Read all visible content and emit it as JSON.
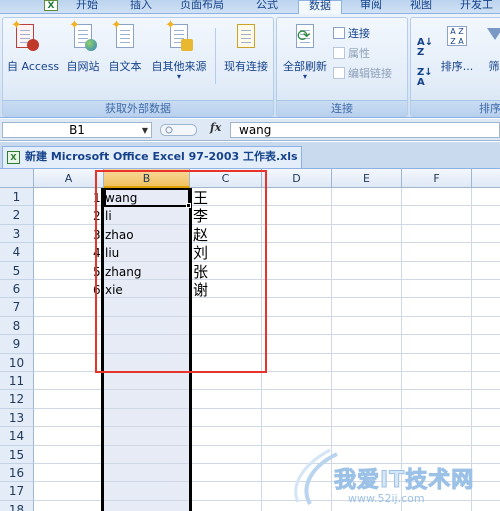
{
  "ribbon": {
    "tabs": [
      {
        "label": "开始",
        "active": false
      },
      {
        "label": "插入",
        "active": false
      },
      {
        "label": "页面布局",
        "active": false
      },
      {
        "label": "公式",
        "active": false
      },
      {
        "label": "数据",
        "active": true
      },
      {
        "label": "审阅",
        "active": false
      },
      {
        "label": "视图",
        "active": false
      },
      {
        "label": "开发工",
        "active": false
      }
    ],
    "app_icon_letter": "X",
    "groups": {
      "external": {
        "label": "获取外部数据",
        "buttons": [
          "自 Access",
          "自网站",
          "自文本",
          "自其他来源",
          "现有连接"
        ]
      },
      "connections": {
        "label": "连接",
        "refresh_all": "全部刷新",
        "connections": "连接",
        "properties": "属性",
        "edit_links": "编辑链接"
      },
      "sort": {
        "label": "排序",
        "sort_button": "排序...",
        "filter_partial": "筛"
      }
    }
  },
  "formula_bar": {
    "name_box": "B1",
    "fx_label": "fx",
    "content": "wang"
  },
  "workbook": {
    "tab_title": "新建 Microsoft Office Excel 97-2003 工作表.xls",
    "file_icon": "X"
  },
  "sheet": {
    "columns": [
      "A",
      "B",
      "C",
      "D",
      "E",
      "F"
    ],
    "rows": [
      "1",
      "2",
      "3",
      "4",
      "5",
      "6",
      "7",
      "8",
      "9",
      "10",
      "11",
      "12",
      "13",
      "14",
      "15",
      "16",
      "17",
      "18"
    ],
    "data": [
      {
        "index": "1",
        "name": "wang",
        "han": "王"
      },
      {
        "index": "2",
        "name": "li",
        "han": "李"
      },
      {
        "index": "3",
        "name": "zhao",
        "han": "赵"
      },
      {
        "index": "4",
        "name": "liu",
        "han": "刘"
      },
      {
        "index": "5",
        "name": "zhang",
        "han": "张"
      },
      {
        "index": "6",
        "name": "xie",
        "han": "谢"
      }
    ],
    "selected_column": "B",
    "active_cell": "B1"
  },
  "watermark": {
    "text": "我爱IT技术网",
    "url": "www.52ij.com"
  },
  "colors": {
    "ribbon_text": "#15428b",
    "selection_header": "#f1c15f",
    "annotation_box": "#e8332a",
    "selected_column_fill": "#e6ebf6"
  }
}
